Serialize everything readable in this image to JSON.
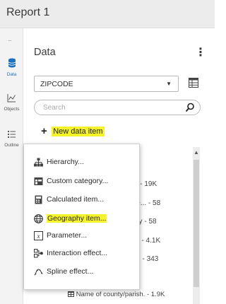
{
  "window": {
    "title": "Report 1"
  },
  "rail": {
    "dots": "∙∙∙",
    "items": [
      {
        "label": "Data",
        "icon": "database-icon",
        "active": true
      },
      {
        "label": "Objects",
        "icon": "line-chart-icon",
        "active": false
      },
      {
        "label": "Outline",
        "icon": "outline-list-icon",
        "active": false
      }
    ]
  },
  "pane": {
    "title": "Data",
    "menu_glyph": "⋮",
    "data_source": "ZIPCODE",
    "caret": "▼",
    "search": {
      "placeholder": "Search"
    },
    "new_data_item_label": "New data item",
    "plus_glyph": "+"
  },
  "background_list": [
    "ge... - 19K",
    "or ge... - 58",
    "rritory - 58",
    "es ... - 4.1K",
    "for ... - 343",
    "9K",
    "Name of county/parish. - 1.9K"
  ],
  "menu": {
    "items": [
      {
        "label": "Hierarchy...",
        "icon": "hierarchy-icon",
        "highlighted": false
      },
      {
        "label": "Custom category...",
        "icon": "custom-category-icon",
        "highlighted": false
      },
      {
        "label": "Calculated item...",
        "icon": "calculator-icon",
        "highlighted": false
      },
      {
        "label": "Geography item...",
        "icon": "globe-icon",
        "highlighted": true
      },
      {
        "label": "Parameter...",
        "icon": "parameter-icon",
        "highlighted": false
      },
      {
        "label": "Interaction effect...",
        "icon": "interaction-effect-icon",
        "highlighted": false
      },
      {
        "label": "Spline effect...",
        "icon": "spline-effect-icon",
        "highlighted": false
      }
    ]
  },
  "colors": {
    "highlight": "#f6f32a",
    "accent": "#1f6fbf",
    "titlebar_bg": "#ececec"
  }
}
